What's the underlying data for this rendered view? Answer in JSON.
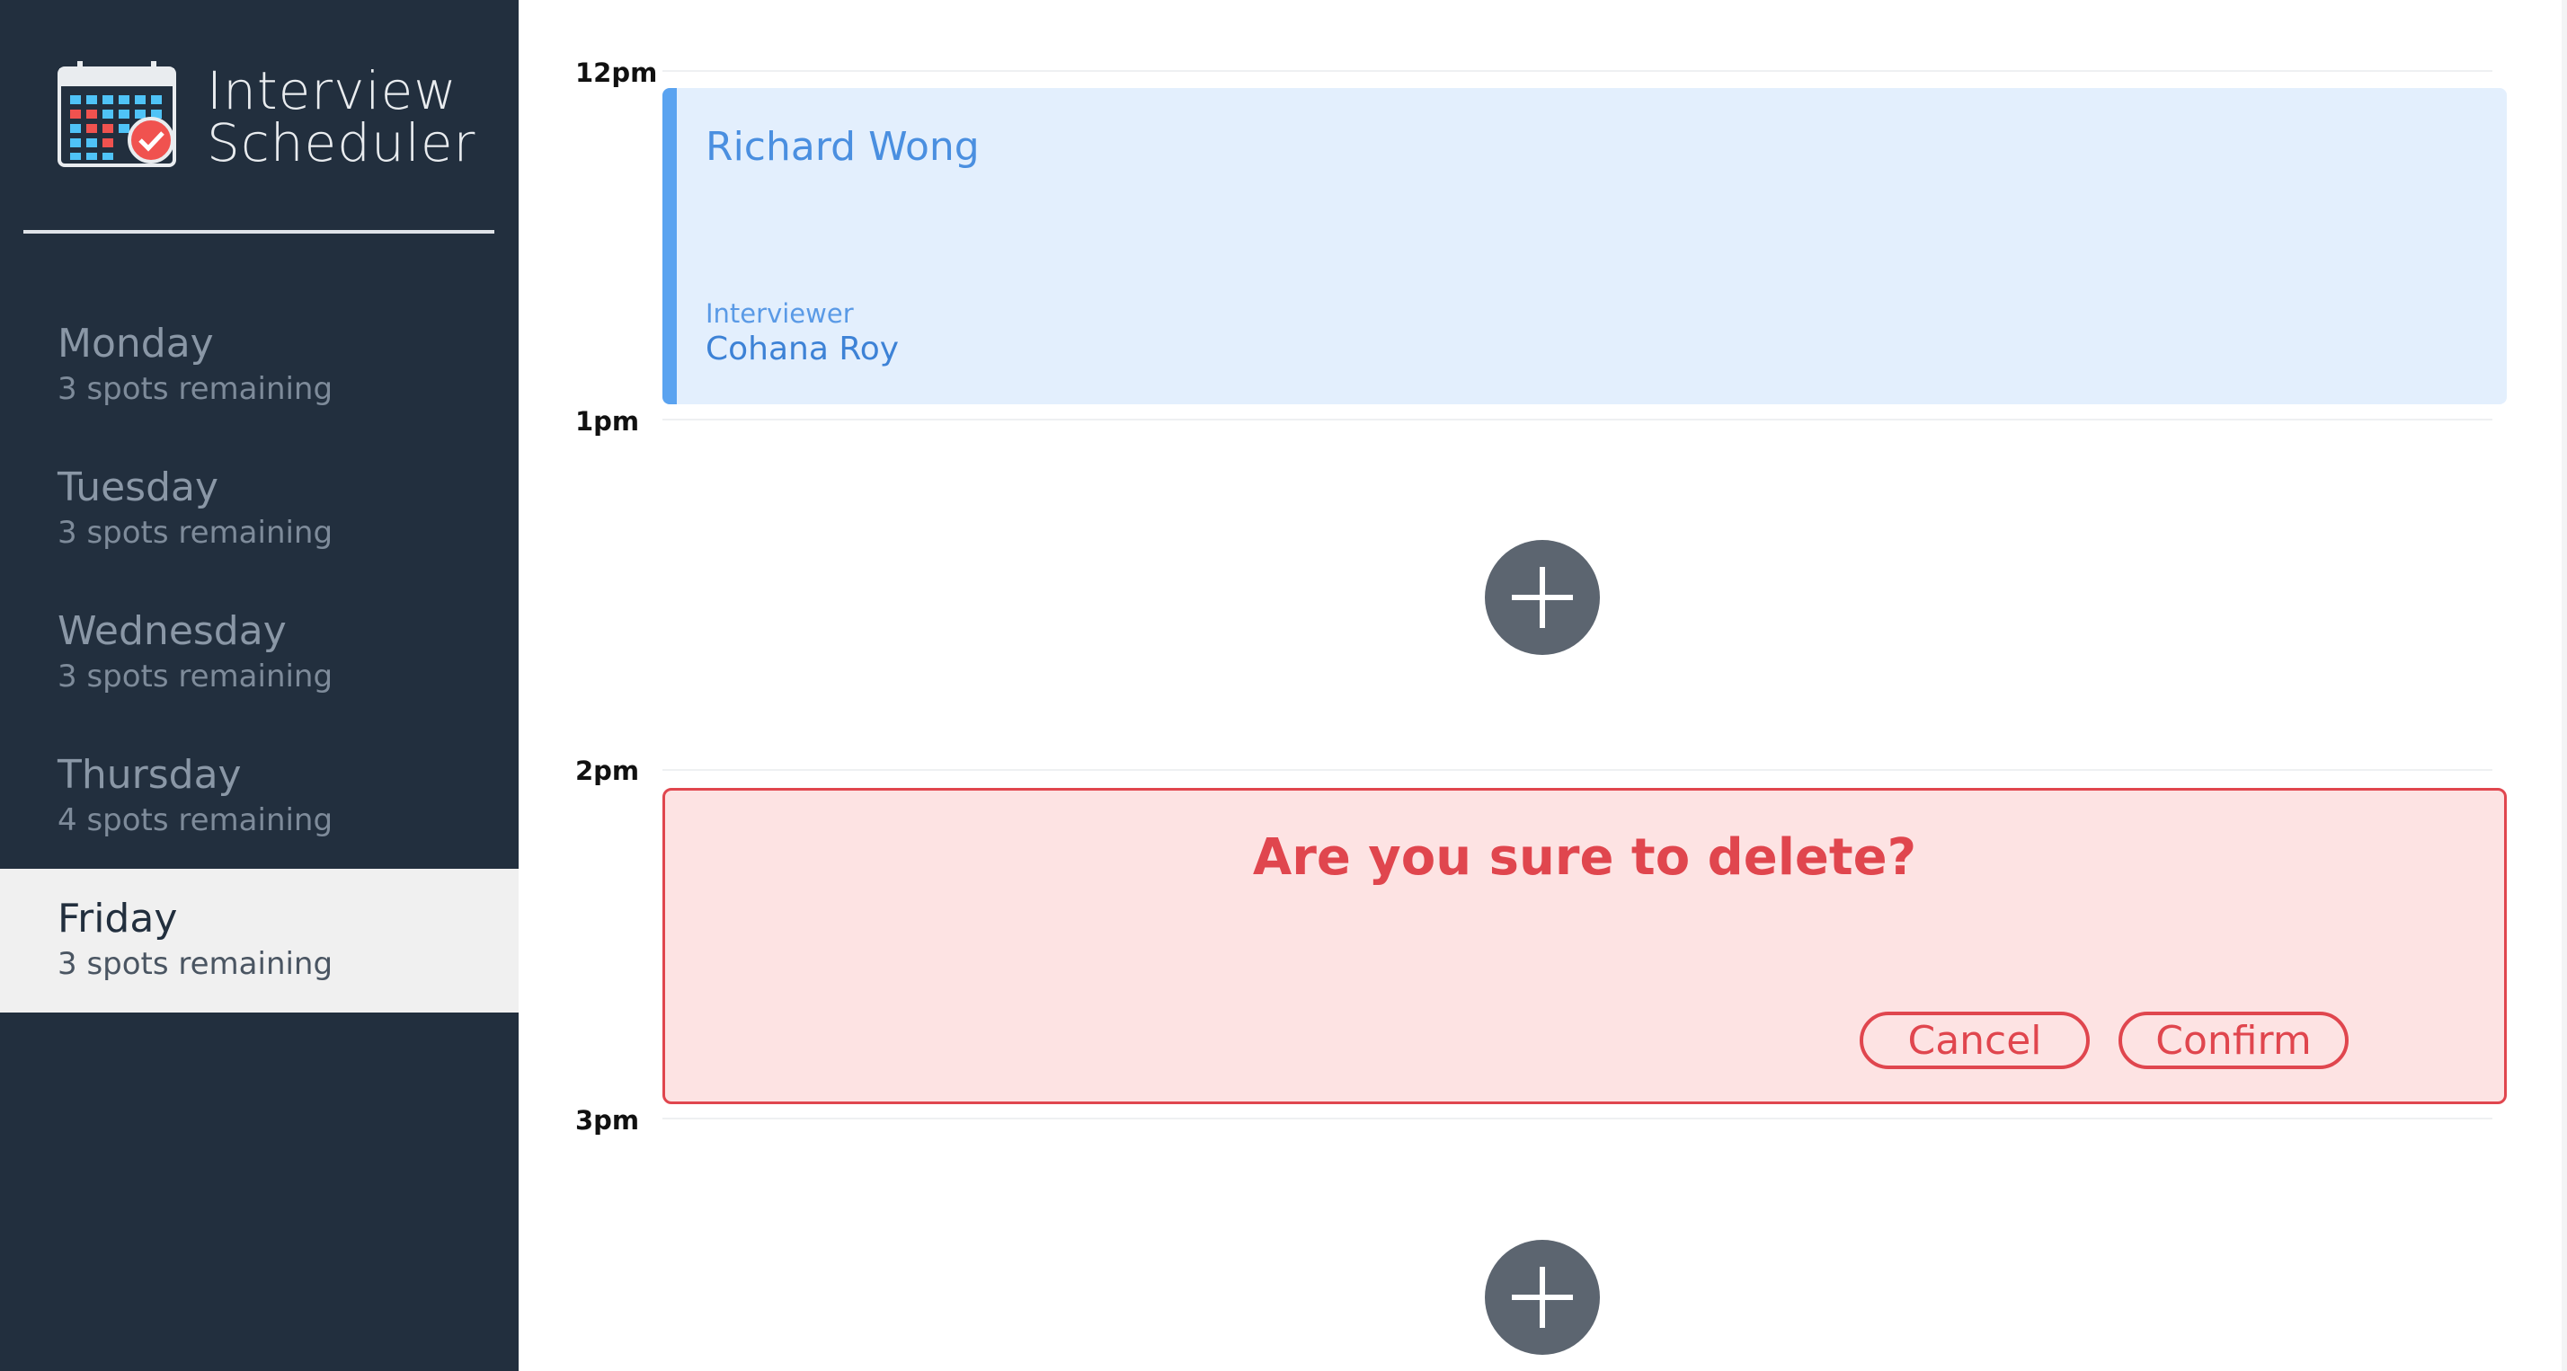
{
  "app": {
    "title_line1": "Interview",
    "title_line2": "Scheduler"
  },
  "sidebar": {
    "days": [
      {
        "name": "Monday",
        "spots": "3 spots remaining"
      },
      {
        "name": "Tuesday",
        "spots": "3 spots remaining"
      },
      {
        "name": "Wednesday",
        "spots": "3 spots remaining"
      },
      {
        "name": "Thursday",
        "spots": "4 spots remaining"
      },
      {
        "name": "Friday",
        "spots": "3 spots remaining",
        "selected": true
      }
    ]
  },
  "schedule": {
    "hours": [
      "12pm",
      "1pm",
      "2pm",
      "3pm"
    ],
    "appointment": {
      "student": "Richard Wong",
      "interviewer_label": "Interviewer",
      "interviewer": "Cohana Roy"
    },
    "confirm": {
      "message": "Are you sure to delete?",
      "cancel_label": "Cancel",
      "confirm_label": "Confirm"
    }
  },
  "colors": {
    "sidebar_bg": "#222f3e",
    "appointment_accent": "#5aa3f0",
    "danger": "#e0464e",
    "add_button": "#5c6570"
  },
  "icons": {
    "logo": "calendar-check-icon",
    "add": "plus-icon"
  }
}
